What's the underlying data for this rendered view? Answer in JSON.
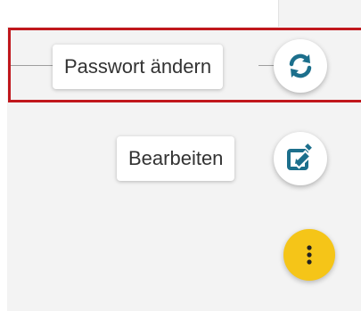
{
  "speed_dial": {
    "actions": [
      {
        "label": "Passwort ändern",
        "icon": "refresh-icon"
      },
      {
        "label": "Bearbeiten",
        "icon": "edit-icon"
      }
    ],
    "toggle_icon": "more-vertical-icon"
  },
  "colors": {
    "accent": "#1c6f8c",
    "fab_main": "#f5c518",
    "highlight": "#c0171c"
  }
}
